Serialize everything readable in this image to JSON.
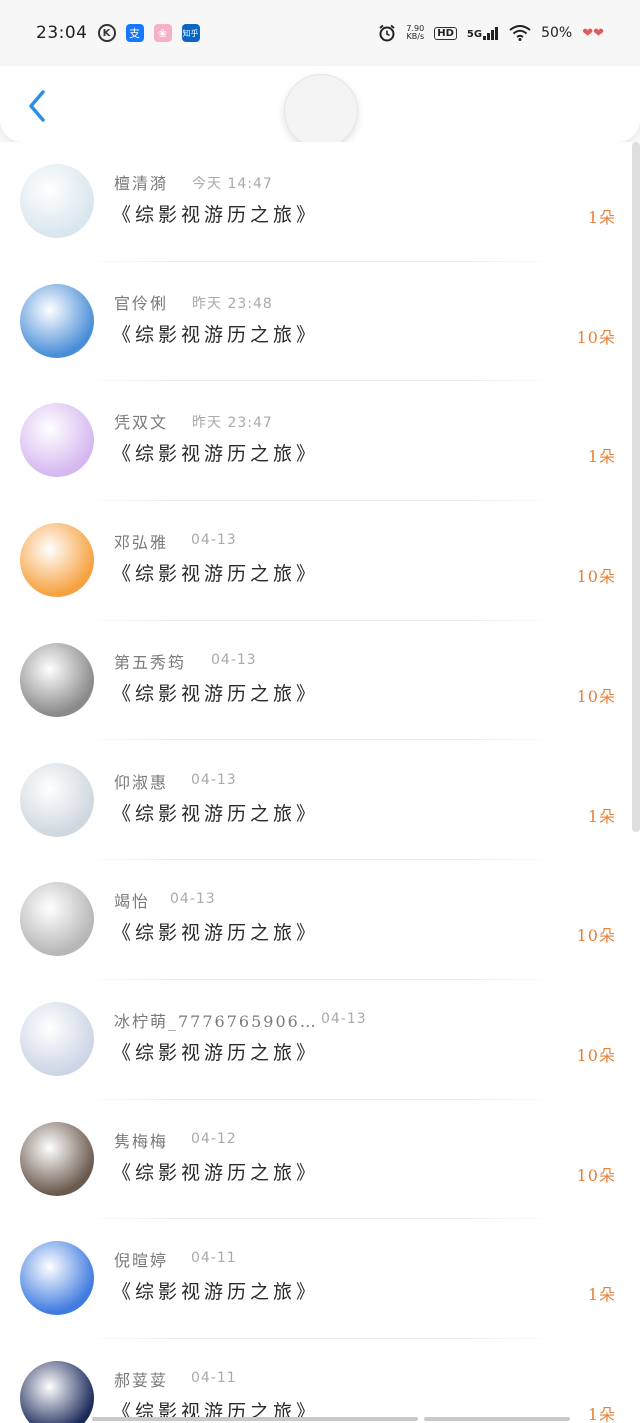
{
  "status_bar": {
    "time": "23:04",
    "net_speed_top": "7.90",
    "net_speed_unit": "KB/s",
    "hd": "HD",
    "signal": "5G",
    "battery": "50%"
  },
  "header": {
    "back_icon": "chevron-left-icon"
  },
  "gifts": [
    {
      "name": "檀清漪",
      "date": "今天 14:47",
      "title": "《综影视游历之旅》",
      "amount": "1朵",
      "avatar_color": "#d9e6ee"
    },
    {
      "name": "官伶俐",
      "date": "昨天 23:48",
      "title": "《综影视游历之旅》",
      "amount": "10朵",
      "avatar_color": "#4a8ed8"
    },
    {
      "name": "凭双文",
      "date": "昨天 23:47",
      "title": "《综影视游历之旅》",
      "amount": "1朵",
      "avatar_color": "#d6b8f0"
    },
    {
      "name": "邓弘雅",
      "date": "04-13",
      "title": "《综影视游历之旅》",
      "amount": "10朵",
      "avatar_color": "#f6a13f"
    },
    {
      "name": "第五秀筠",
      "date": "04-13",
      "title": "《综影视游历之旅》",
      "amount": "10朵",
      "avatar_color": "#8a8a8a"
    },
    {
      "name": "仰淑惠",
      "date": "04-13",
      "title": "《综影视游历之旅》",
      "amount": "1朵",
      "avatar_color": "#cfd8df"
    },
    {
      "name": "竭怡",
      "date": "04-13",
      "title": "《综影视游历之旅》",
      "amount": "10朵",
      "avatar_color": "#b7b7b7"
    },
    {
      "name": "冰柠萌_7776765906…",
      "date": "04-13",
      "title": "《综影视游历之旅》",
      "amount": "10朵",
      "avatar_color": "#cdd6e6"
    },
    {
      "name": "隽梅梅",
      "date": "04-12",
      "title": "《综影视游历之旅》",
      "amount": "10朵",
      "avatar_color": "#6b5a4e"
    },
    {
      "name": "倪暄婷",
      "date": "04-11",
      "title": "《综影视游历之旅》",
      "amount": "1朵",
      "avatar_color": "#3f7be0"
    },
    {
      "name": "郝荽荽",
      "date": "04-11",
      "title": "《综影视游历之旅》",
      "amount": "1朵",
      "avatar_color": "#1b2a5a"
    }
  ]
}
